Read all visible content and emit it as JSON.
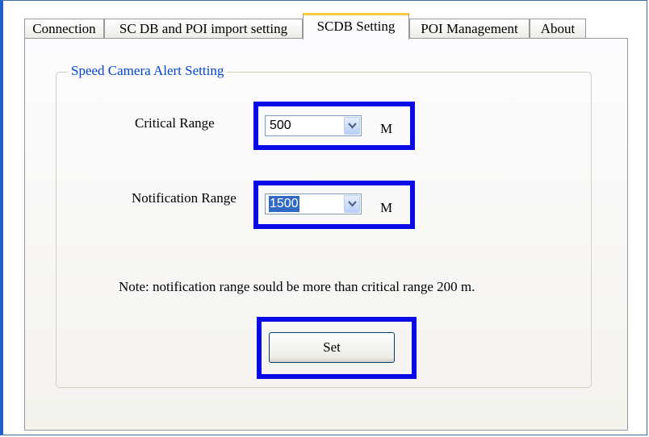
{
  "tabs": [
    {
      "label": "Connection",
      "active": false
    },
    {
      "label": "SC DB and POI import setting",
      "active": false
    },
    {
      "label": "SCDB Setting",
      "active": true
    },
    {
      "label": "POI Management",
      "active": false
    },
    {
      "label": "About",
      "active": false
    }
  ],
  "group": {
    "title": "Speed Camera Alert Setting",
    "critical": {
      "label": "Critical Range",
      "value": "500",
      "unit": "M"
    },
    "notification": {
      "label": "Notification Range",
      "value": "1500",
      "unit": "M"
    },
    "note": "Note: notification range sould be more than  critical range 200 m.",
    "set_button": "Set"
  },
  "colors": {
    "highlight": "#0a0ae6",
    "group_title": "#0046d5",
    "active_tab_accent": "#ffc73c",
    "selection": "#316ac5"
  },
  "icons": {
    "combo_arrow": "chevron-down-icon"
  }
}
